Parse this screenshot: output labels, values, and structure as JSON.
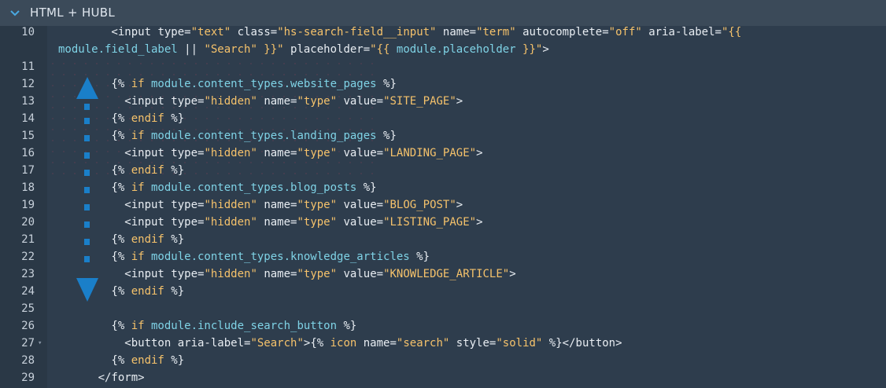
{
  "header": {
    "title": "HTML + HUBL",
    "chevron_icon": "chevron-down-icon"
  },
  "colors": {
    "background": "#2e3d4d",
    "gutter": "#2a3846",
    "header": "#3b4a59",
    "text": "#e8edf2",
    "keyword": "#f5c26b",
    "variable": "#7fd3e6",
    "arrow": "#1a7fc9"
  },
  "lines": [
    {
      "n": "10",
      "segs": [
        {
          "t": "        <input ",
          "c": "pre"
        },
        {
          "t": "type=",
          "c": "pre"
        },
        {
          "t": "\"text\"",
          "c": "val"
        },
        {
          "t": " class=",
          "c": "pre"
        },
        {
          "t": "\"hs-search-field__input\"",
          "c": "val"
        },
        {
          "t": " name=",
          "c": "pre"
        },
        {
          "t": "\"term\"",
          "c": "val"
        },
        {
          "t": " autocomplete=",
          "c": "pre"
        },
        {
          "t": "\"off\"",
          "c": "val"
        },
        {
          "t": " aria-label=",
          "c": "pre"
        },
        {
          "t": "\"{{",
          "c": "val"
        }
      ]
    },
    {
      "n": "",
      "segs": [
        {
          "t": "module.field_label",
          "c": "var"
        },
        {
          "t": " || ",
          "c": "pre"
        },
        {
          "t": "\"Search\"",
          "c": "val"
        },
        {
          "t": " }}\"",
          "c": "val"
        },
        {
          "t": " placeholder=",
          "c": "pre"
        },
        {
          "t": "\"{{ ",
          "c": "val"
        },
        {
          "t": "module.placeholder",
          "c": "var"
        },
        {
          "t": " }}\"",
          "c": "val"
        },
        {
          "t": ">",
          "c": "pre"
        }
      ]
    },
    {
      "n": "11",
      "segs": []
    },
    {
      "n": "12",
      "segs": [
        {
          "t": "        {% ",
          "c": "pre"
        },
        {
          "t": "if",
          "c": "kw"
        },
        {
          "t": " module.content_types.website_pages",
          "c": "var"
        },
        {
          "t": " %}",
          "c": "pre"
        }
      ]
    },
    {
      "n": "13",
      "segs": [
        {
          "t": "          <input ",
          "c": "pre"
        },
        {
          "t": "type=",
          "c": "pre"
        },
        {
          "t": "\"hidden\"",
          "c": "val"
        },
        {
          "t": " name=",
          "c": "pre"
        },
        {
          "t": "\"type\"",
          "c": "val"
        },
        {
          "t": " value=",
          "c": "pre"
        },
        {
          "t": "\"SITE_PAGE\"",
          "c": "val"
        },
        {
          "t": ">",
          "c": "pre"
        }
      ]
    },
    {
      "n": "14",
      "segs": [
        {
          "t": "        {% ",
          "c": "pre"
        },
        {
          "t": "endif",
          "c": "kw"
        },
        {
          "t": " %}",
          "c": "pre"
        }
      ]
    },
    {
      "n": "15",
      "segs": [
        {
          "t": "        {% ",
          "c": "pre"
        },
        {
          "t": "if",
          "c": "kw"
        },
        {
          "t": " module.content_types.landing_pages",
          "c": "var"
        },
        {
          "t": " %}",
          "c": "pre"
        }
      ]
    },
    {
      "n": "16",
      "segs": [
        {
          "t": "          <input ",
          "c": "pre"
        },
        {
          "t": "type=",
          "c": "pre"
        },
        {
          "t": "\"hidden\"",
          "c": "val"
        },
        {
          "t": " name=",
          "c": "pre"
        },
        {
          "t": "\"type\"",
          "c": "val"
        },
        {
          "t": " value=",
          "c": "pre"
        },
        {
          "t": "\"LANDING_PAGE\"",
          "c": "val"
        },
        {
          "t": ">",
          "c": "pre"
        }
      ]
    },
    {
      "n": "17",
      "segs": [
        {
          "t": "        {% ",
          "c": "pre"
        },
        {
          "t": "endif",
          "c": "kw"
        },
        {
          "t": " %}",
          "c": "pre"
        }
      ]
    },
    {
      "n": "18",
      "segs": [
        {
          "t": "        {% ",
          "c": "pre"
        },
        {
          "t": "if",
          "c": "kw"
        },
        {
          "t": " module.content_types.blog_posts",
          "c": "var"
        },
        {
          "t": " %}",
          "c": "pre"
        }
      ]
    },
    {
      "n": "19",
      "segs": [
        {
          "t": "          <input ",
          "c": "pre"
        },
        {
          "t": "type=",
          "c": "pre"
        },
        {
          "t": "\"hidden\"",
          "c": "val"
        },
        {
          "t": " name=",
          "c": "pre"
        },
        {
          "t": "\"type\"",
          "c": "val"
        },
        {
          "t": " value=",
          "c": "pre"
        },
        {
          "t": "\"BLOG_POST\"",
          "c": "val"
        },
        {
          "t": ">",
          "c": "pre"
        }
      ]
    },
    {
      "n": "20",
      "segs": [
        {
          "t": "          <input ",
          "c": "pre"
        },
        {
          "t": "type=",
          "c": "pre"
        },
        {
          "t": "\"hidden\"",
          "c": "val"
        },
        {
          "t": " name=",
          "c": "pre"
        },
        {
          "t": "\"type\"",
          "c": "val"
        },
        {
          "t": " value=",
          "c": "pre"
        },
        {
          "t": "\"LISTING_PAGE\"",
          "c": "val"
        },
        {
          "t": ">",
          "c": "pre"
        }
      ]
    },
    {
      "n": "21",
      "segs": [
        {
          "t": "        {% ",
          "c": "pre"
        },
        {
          "t": "endif",
          "c": "kw"
        },
        {
          "t": " %}",
          "c": "pre"
        }
      ]
    },
    {
      "n": "22",
      "segs": [
        {
          "t": "        {% ",
          "c": "pre"
        },
        {
          "t": "if",
          "c": "kw"
        },
        {
          "t": " module.content_types.knowledge_articles",
          "c": "var"
        },
        {
          "t": " %}",
          "c": "pre"
        }
      ]
    },
    {
      "n": "23",
      "segs": [
        {
          "t": "          <input ",
          "c": "pre"
        },
        {
          "t": "type=",
          "c": "pre"
        },
        {
          "t": "\"hidden\"",
          "c": "val"
        },
        {
          "t": " name=",
          "c": "pre"
        },
        {
          "t": "\"type\"",
          "c": "val"
        },
        {
          "t": " value=",
          "c": "pre"
        },
        {
          "t": "\"KNOWLEDGE_ARTICLE\"",
          "c": "val"
        },
        {
          "t": ">",
          "c": "pre"
        }
      ]
    },
    {
      "n": "24",
      "segs": [
        {
          "t": "        {% ",
          "c": "pre"
        },
        {
          "t": "endif",
          "c": "kw"
        },
        {
          "t": " %}",
          "c": "pre"
        }
      ]
    },
    {
      "n": "25",
      "segs": []
    },
    {
      "n": "26",
      "segs": [
        {
          "t": "        {% ",
          "c": "pre"
        },
        {
          "t": "if",
          "c": "kw"
        },
        {
          "t": " module.include_search_button",
          "c": "var"
        },
        {
          "t": " %}",
          "c": "pre"
        }
      ]
    },
    {
      "n": "27",
      "fold": true,
      "segs": [
        {
          "t": "          <button ",
          "c": "pre"
        },
        {
          "t": "aria-label=",
          "c": "pre"
        },
        {
          "t": "\"Search\"",
          "c": "val"
        },
        {
          "t": ">",
          "c": "pre"
        },
        {
          "t": "{% ",
          "c": "pre"
        },
        {
          "t": "icon",
          "c": "kw"
        },
        {
          "t": " name=",
          "c": "pre"
        },
        {
          "t": "\"search\"",
          "c": "val"
        },
        {
          "t": " style=",
          "c": "pre"
        },
        {
          "t": "\"solid\"",
          "c": "val"
        },
        {
          "t": " %}",
          "c": "pre"
        },
        {
          "t": "</button>",
          "c": "pre"
        }
      ]
    },
    {
      "n": "28",
      "segs": [
        {
          "t": "        {% ",
          "c": "pre"
        },
        {
          "t": "endif",
          "c": "kw"
        },
        {
          "t": " %}",
          "c": "pre"
        }
      ]
    },
    {
      "n": "29",
      "segs": [
        {
          "t": "      </form>",
          "c": "pre"
        }
      ]
    }
  ]
}
